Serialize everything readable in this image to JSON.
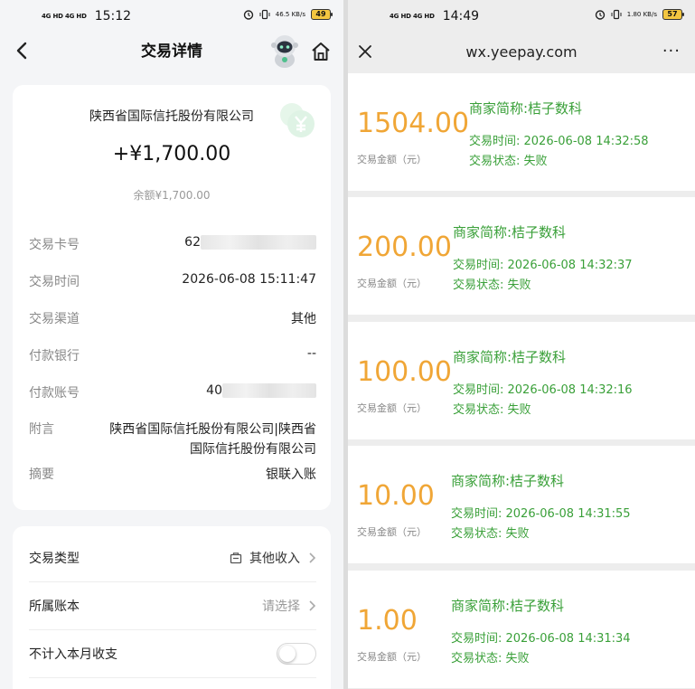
{
  "left": {
    "status": {
      "network": "4G HD 4G HD",
      "time": "15:12",
      "speed": "46.5 KB/s",
      "battery": "49"
    },
    "header": {
      "title": "交易详情"
    },
    "card": {
      "bank_name": "陕西省国际信托股份有限公司",
      "amount": "+¥1,700.00",
      "balance": "余额¥1,700.00",
      "rows": [
        {
          "label": "交易卡号",
          "value": "62"
        },
        {
          "label": "交易时间",
          "value": "2026-06-08 15:11:47"
        },
        {
          "label": "交易渠道",
          "value": "其他"
        },
        {
          "label": "付款银行",
          "value": "--"
        },
        {
          "label": "付款账号",
          "value": "40"
        },
        {
          "label": "附言",
          "value": "陕西省国际信托股份有限公司|陕西省国际信托股份有限公司"
        },
        {
          "label": "摘要",
          "value": "银联入账"
        }
      ]
    },
    "settings": {
      "type_label": "交易类型",
      "type_value": "其他收入",
      "book_label": "所属账本",
      "book_value": "请选择",
      "exclude_label": "不计入本月收支",
      "exclude_on": false
    }
  },
  "right": {
    "status": {
      "network": "4G HD 4G HD",
      "time": "14:49",
      "speed": "1.80 KB/s",
      "battery": "57"
    },
    "header": {
      "url": "wx.yeepay.com",
      "more": "···"
    },
    "amount_label": "交易金额（元）",
    "transactions": [
      {
        "amount": "1504.00",
        "merchant": "商家简称:桔子数科",
        "time": "交易时间: 2026-06-08 14:32:58",
        "status": "交易状态: 失败"
      },
      {
        "amount": "200.00",
        "merchant": "商家简称:桔子数科",
        "time": "交易时间: 2026-06-08 14:32:37",
        "status": "交易状态: 失败"
      },
      {
        "amount": "100.00",
        "merchant": "商家简称:桔子数科",
        "time": "交易时间: 2026-06-08 14:32:16",
        "status": "交易状态: 失败"
      },
      {
        "amount": "10.00",
        "merchant": "商家简称:桔子数科",
        "time": "交易时间: 2026-06-08 14:31:55",
        "status": "交易状态: 失败"
      },
      {
        "amount": "1.00",
        "merchant": "商家简称:桔子数科",
        "time": "交易时间: 2026-06-08 14:31:34",
        "status": "交易状态: 失败"
      }
    ]
  },
  "colors": {
    "amount_orange": "#f0a636",
    "merchant_green": "#3aa039",
    "label_gray": "#888888"
  }
}
